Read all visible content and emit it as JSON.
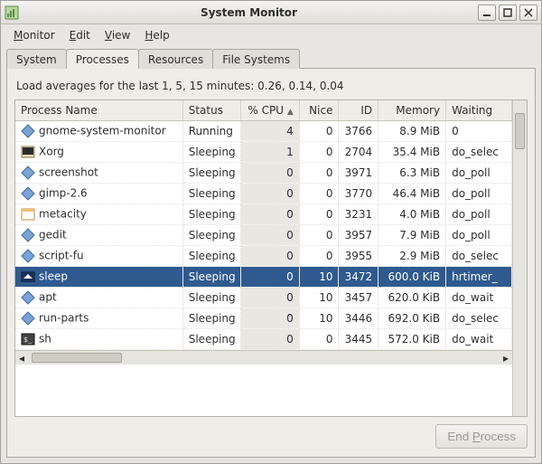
{
  "window": {
    "title": "System Monitor"
  },
  "menubar": {
    "monitor": "Monitor",
    "edit": "Edit",
    "view": "View",
    "help": "Help"
  },
  "tabs": {
    "system": "System",
    "processes": "Processes",
    "resources": "Resources",
    "filesystems": "File Systems"
  },
  "loadavg_text": "Load averages for the last 1, 5, 15 minutes: 0.26, 0.14, 0.04",
  "columns": {
    "name": "Process Name",
    "status": "Status",
    "cpu": "% CPU",
    "nice": "Nice",
    "id": "ID",
    "memory": "Memory",
    "waiting": "Waiting"
  },
  "sort_indicator": "▲",
  "processes": [
    {
      "icon": "diamond",
      "name": "gnome-system-monitor",
      "status": "Running",
      "cpu": "4",
      "nice": "0",
      "id": "3766",
      "memory": "8.9 MiB",
      "waiting": "0",
      "selected": false
    },
    {
      "icon": "term",
      "name": "Xorg",
      "status": "Sleeping",
      "cpu": "1",
      "nice": "0",
      "id": "2704",
      "memory": "35.4 MiB",
      "waiting": "do_selec",
      "selected": false
    },
    {
      "icon": "diamond",
      "name": "screenshot",
      "status": "Sleeping",
      "cpu": "0",
      "nice": "0",
      "id": "3971",
      "memory": "6.3 MiB",
      "waiting": "do_poll",
      "selected": false
    },
    {
      "icon": "diamond",
      "name": "gimp-2.6",
      "status": "Sleeping",
      "cpu": "0",
      "nice": "0",
      "id": "3770",
      "memory": "46.4 MiB",
      "waiting": "do_poll",
      "selected": false
    },
    {
      "icon": "window",
      "name": "metacity",
      "status": "Sleeping",
      "cpu": "0",
      "nice": "0",
      "id": "3231",
      "memory": "4.0 MiB",
      "waiting": "do_poll",
      "selected": false
    },
    {
      "icon": "diamond",
      "name": "gedit",
      "status": "Sleeping",
      "cpu": "0",
      "nice": "0",
      "id": "3957",
      "memory": "7.9 MiB",
      "waiting": "do_poll",
      "selected": false
    },
    {
      "icon": "diamond",
      "name": "script-fu",
      "status": "Sleeping",
      "cpu": "0",
      "nice": "0",
      "id": "3955",
      "memory": "2.9 MiB",
      "waiting": "do_selec",
      "selected": false
    },
    {
      "icon": "screen",
      "name": "sleep",
      "status": "Sleeping",
      "cpu": "0",
      "nice": "10",
      "id": "3472",
      "memory": "600.0 KiB",
      "waiting": "hrtimer_",
      "selected": true
    },
    {
      "icon": "diamond",
      "name": "apt",
      "status": "Sleeping",
      "cpu": "0",
      "nice": "10",
      "id": "3457",
      "memory": "620.0 KiB",
      "waiting": "do_wait",
      "selected": false
    },
    {
      "icon": "diamond",
      "name": "run-parts",
      "status": "Sleeping",
      "cpu": "0",
      "nice": "10",
      "id": "3446",
      "memory": "692.0 KiB",
      "waiting": "do_selec",
      "selected": false
    },
    {
      "icon": "termbw",
      "name": "sh",
      "status": "Sleeping",
      "cpu": "0",
      "nice": "0",
      "id": "3445",
      "memory": "572.0 KiB",
      "waiting": "do_wait",
      "selected": false
    }
  ],
  "footer": {
    "end_process": "End Process"
  }
}
